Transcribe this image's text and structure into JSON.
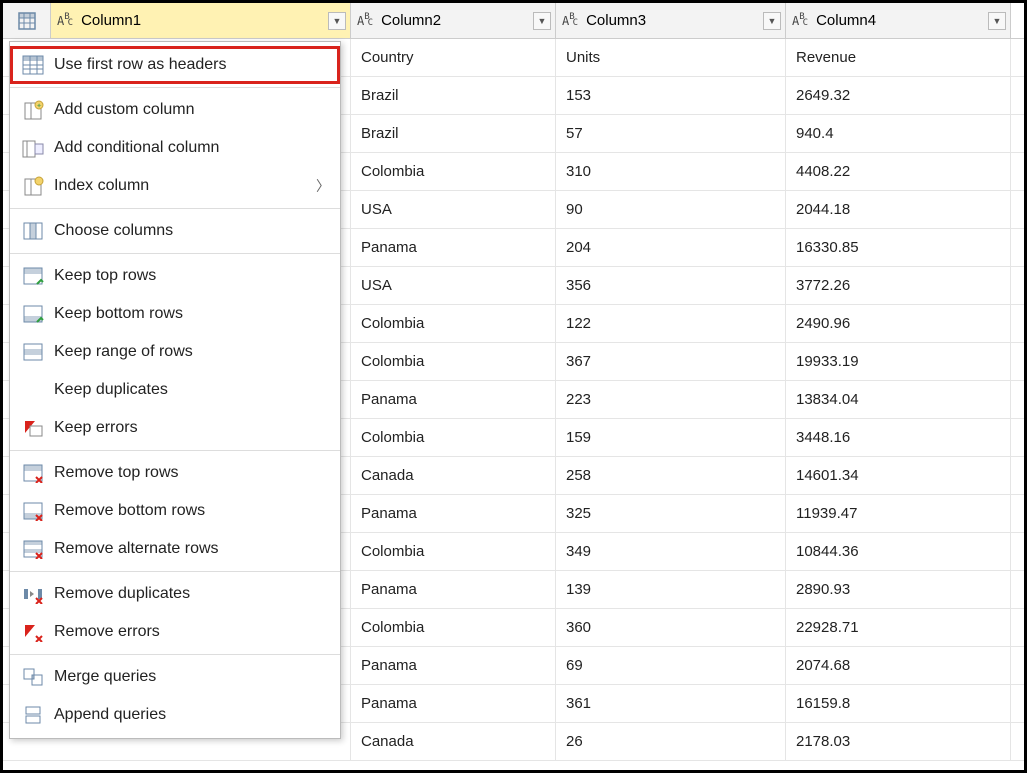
{
  "columns": {
    "col1": "Column1",
    "col2": "Column2",
    "col3": "Column3",
    "col4": "Column4"
  },
  "rows": [
    {
      "c1": "",
      "c2": "Country",
      "c3": "Units",
      "c4": "Revenue"
    },
    {
      "c1": "",
      "c2": "Brazil",
      "c3": "153",
      "c4": "2649.32"
    },
    {
      "c1": "",
      "c2": "Brazil",
      "c3": "57",
      "c4": "940.4"
    },
    {
      "c1": "",
      "c2": "Colombia",
      "c3": "310",
      "c4": "4408.22"
    },
    {
      "c1": "",
      "c2": "USA",
      "c3": "90",
      "c4": "2044.18"
    },
    {
      "c1": "",
      "c2": "Panama",
      "c3": "204",
      "c4": "16330.85"
    },
    {
      "c1": "",
      "c2": "USA",
      "c3": "356",
      "c4": "3772.26"
    },
    {
      "c1": "",
      "c2": "Colombia",
      "c3": "122",
      "c4": "2490.96"
    },
    {
      "c1": "",
      "c2": "Colombia",
      "c3": "367",
      "c4": "19933.19"
    },
    {
      "c1": "",
      "c2": "Panama",
      "c3": "223",
      "c4": "13834.04"
    },
    {
      "c1": "",
      "c2": "Colombia",
      "c3": "159",
      "c4": "3448.16"
    },
    {
      "c1": "",
      "c2": "Canada",
      "c3": "258",
      "c4": "14601.34"
    },
    {
      "c1": "",
      "c2": "Panama",
      "c3": "325",
      "c4": "11939.47"
    },
    {
      "c1": "",
      "c2": "Colombia",
      "c3": "349",
      "c4": "10844.36"
    },
    {
      "c1": "",
      "c2": "Panama",
      "c3": "139",
      "c4": "2890.93"
    },
    {
      "c1": "",
      "c2": "Colombia",
      "c3": "360",
      "c4": "22928.71"
    },
    {
      "c1": "",
      "c2": "Panama",
      "c3": "69",
      "c4": "2074.68"
    },
    {
      "c1": "",
      "c2": "Panama",
      "c3": "361",
      "c4": "16159.8"
    },
    {
      "c1": "",
      "c2": "Canada",
      "c3": "26",
      "c4": "2178.03"
    }
  ],
  "menu": {
    "use_first_row": "Use first row as headers",
    "add_custom": "Add custom column",
    "add_conditional": "Add conditional column",
    "index_column": "Index column",
    "choose_columns": "Choose columns",
    "keep_top": "Keep top rows",
    "keep_bottom": "Keep bottom rows",
    "keep_range": "Keep range of rows",
    "keep_duplicates": "Keep duplicates",
    "keep_errors": "Keep errors",
    "remove_top": "Remove top rows",
    "remove_bottom": "Remove bottom rows",
    "remove_alternate": "Remove alternate rows",
    "remove_duplicates": "Remove duplicates",
    "remove_errors": "Remove errors",
    "merge_queries": "Merge queries",
    "append_queries": "Append queries"
  }
}
